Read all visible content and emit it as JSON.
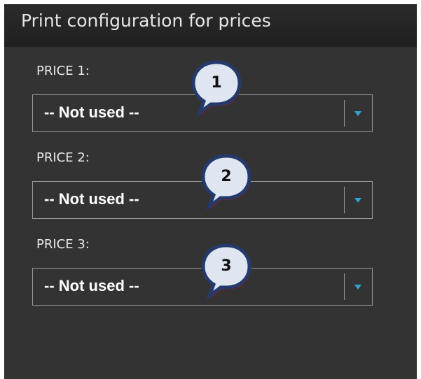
{
  "panel": {
    "title": "Print configuration for prices"
  },
  "prices": [
    {
      "label": "PRICE 1:",
      "value": "-- Not used --",
      "callout": "1"
    },
    {
      "label": "PRICE 2:",
      "value": "-- Not used --",
      "callout": "2"
    },
    {
      "label": "PRICE 3:",
      "value": "-- Not used --",
      "callout": "3"
    }
  ],
  "colors": {
    "panel_bg": "#333333",
    "header_bg": "#222222",
    "dropdown_arrow": "#2ea4d6",
    "callout_fill": "#dfe6f2",
    "callout_border": "#243a6b"
  },
  "icons": {
    "dropdown": "chevron-down-icon",
    "callout": "speech-bubble-icon"
  }
}
